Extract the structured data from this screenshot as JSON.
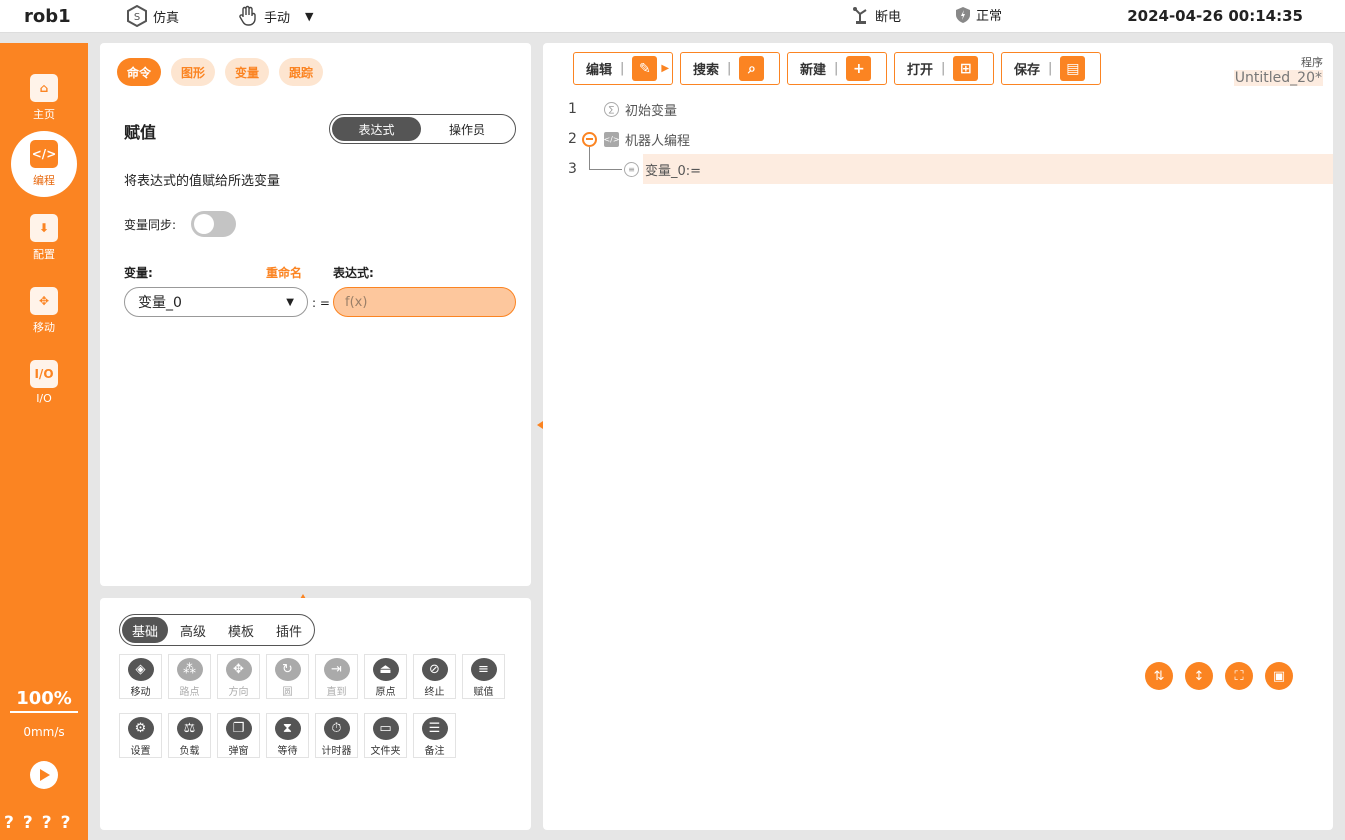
{
  "topbar": {
    "robot_name": "rob1",
    "sim_label": "仿真",
    "mode_label": "手动",
    "power_label": "断电",
    "status_label": "正常",
    "datetime": "2024-04-26 00:14:35"
  },
  "sidebar": {
    "items": [
      {
        "label": "主页",
        "icon": "home-icon"
      },
      {
        "label": "编程",
        "icon": "code-icon"
      },
      {
        "label": "配置",
        "icon": "download-icon"
      },
      {
        "label": "移动",
        "icon": "move-icon"
      },
      {
        "label": "I/O",
        "icon": "io-icon"
      }
    ],
    "speed_percent": "100%",
    "speed_value": "0mm/s",
    "question_marks": "????"
  },
  "command_panel": {
    "tabs": [
      "命令",
      "图形",
      "变量",
      "跟踪"
    ],
    "title": "赋值",
    "mode_options": [
      "表达式",
      "操作员"
    ],
    "description": "将表达式的值赋给所选变量",
    "sync_label": "变量同步:",
    "variable_label": "变量:",
    "rename_label": "重命名",
    "expression_label": "表达式:",
    "selected_variable": "变量_0",
    "assign_op": ": =",
    "expression_placeholder": "f(x)"
  },
  "library_panel": {
    "tabs": [
      "基础",
      "高级",
      "模板",
      "插件"
    ],
    "row1": [
      {
        "label": "移动",
        "icon": "move-cmd-icon",
        "enabled": true
      },
      {
        "label": "路点",
        "icon": "waypoint-icon",
        "enabled": false
      },
      {
        "label": "方向",
        "icon": "direction-icon",
        "enabled": false
      },
      {
        "label": "圆",
        "icon": "circle-icon",
        "enabled": false
      },
      {
        "label": "直到",
        "icon": "until-icon",
        "enabled": false
      },
      {
        "label": "原点",
        "icon": "origin-icon",
        "enabled": true
      },
      {
        "label": "终止",
        "icon": "stop-icon",
        "enabled": true
      },
      {
        "label": "赋值",
        "icon": "assign-icon",
        "enabled": true
      }
    ],
    "row2": [
      {
        "label": "设置",
        "icon": "settings-icon",
        "enabled": true
      },
      {
        "label": "负载",
        "icon": "payload-icon",
        "enabled": true
      },
      {
        "label": "弹窗",
        "icon": "popup-icon",
        "enabled": true
      },
      {
        "label": "等待",
        "icon": "wait-icon",
        "enabled": true
      },
      {
        "label": "计时器",
        "icon": "timer-icon",
        "enabled": true
      },
      {
        "label": "文件夹",
        "icon": "folder-icon",
        "enabled": true
      },
      {
        "label": "备注",
        "icon": "comment-icon",
        "enabled": true
      }
    ]
  },
  "program_panel": {
    "buttons": [
      {
        "label": "编辑",
        "icon": "edit-icon"
      },
      {
        "label": "搜索",
        "icon": "search-icon"
      },
      {
        "label": "新建",
        "icon": "new-icon"
      },
      {
        "label": "打开",
        "icon": "open-folder-icon"
      },
      {
        "label": "保存",
        "icon": "save-icon"
      }
    ],
    "program_label": "程序",
    "program_name": "Untitled_20*",
    "lines": [
      {
        "num": "1",
        "text": "初始变量"
      },
      {
        "num": "2",
        "text": "机器人编程"
      },
      {
        "num": "3",
        "text": "变量_0:="
      }
    ]
  },
  "colors": {
    "accent": "#fb8422",
    "selected_line": "#fdece0"
  }
}
